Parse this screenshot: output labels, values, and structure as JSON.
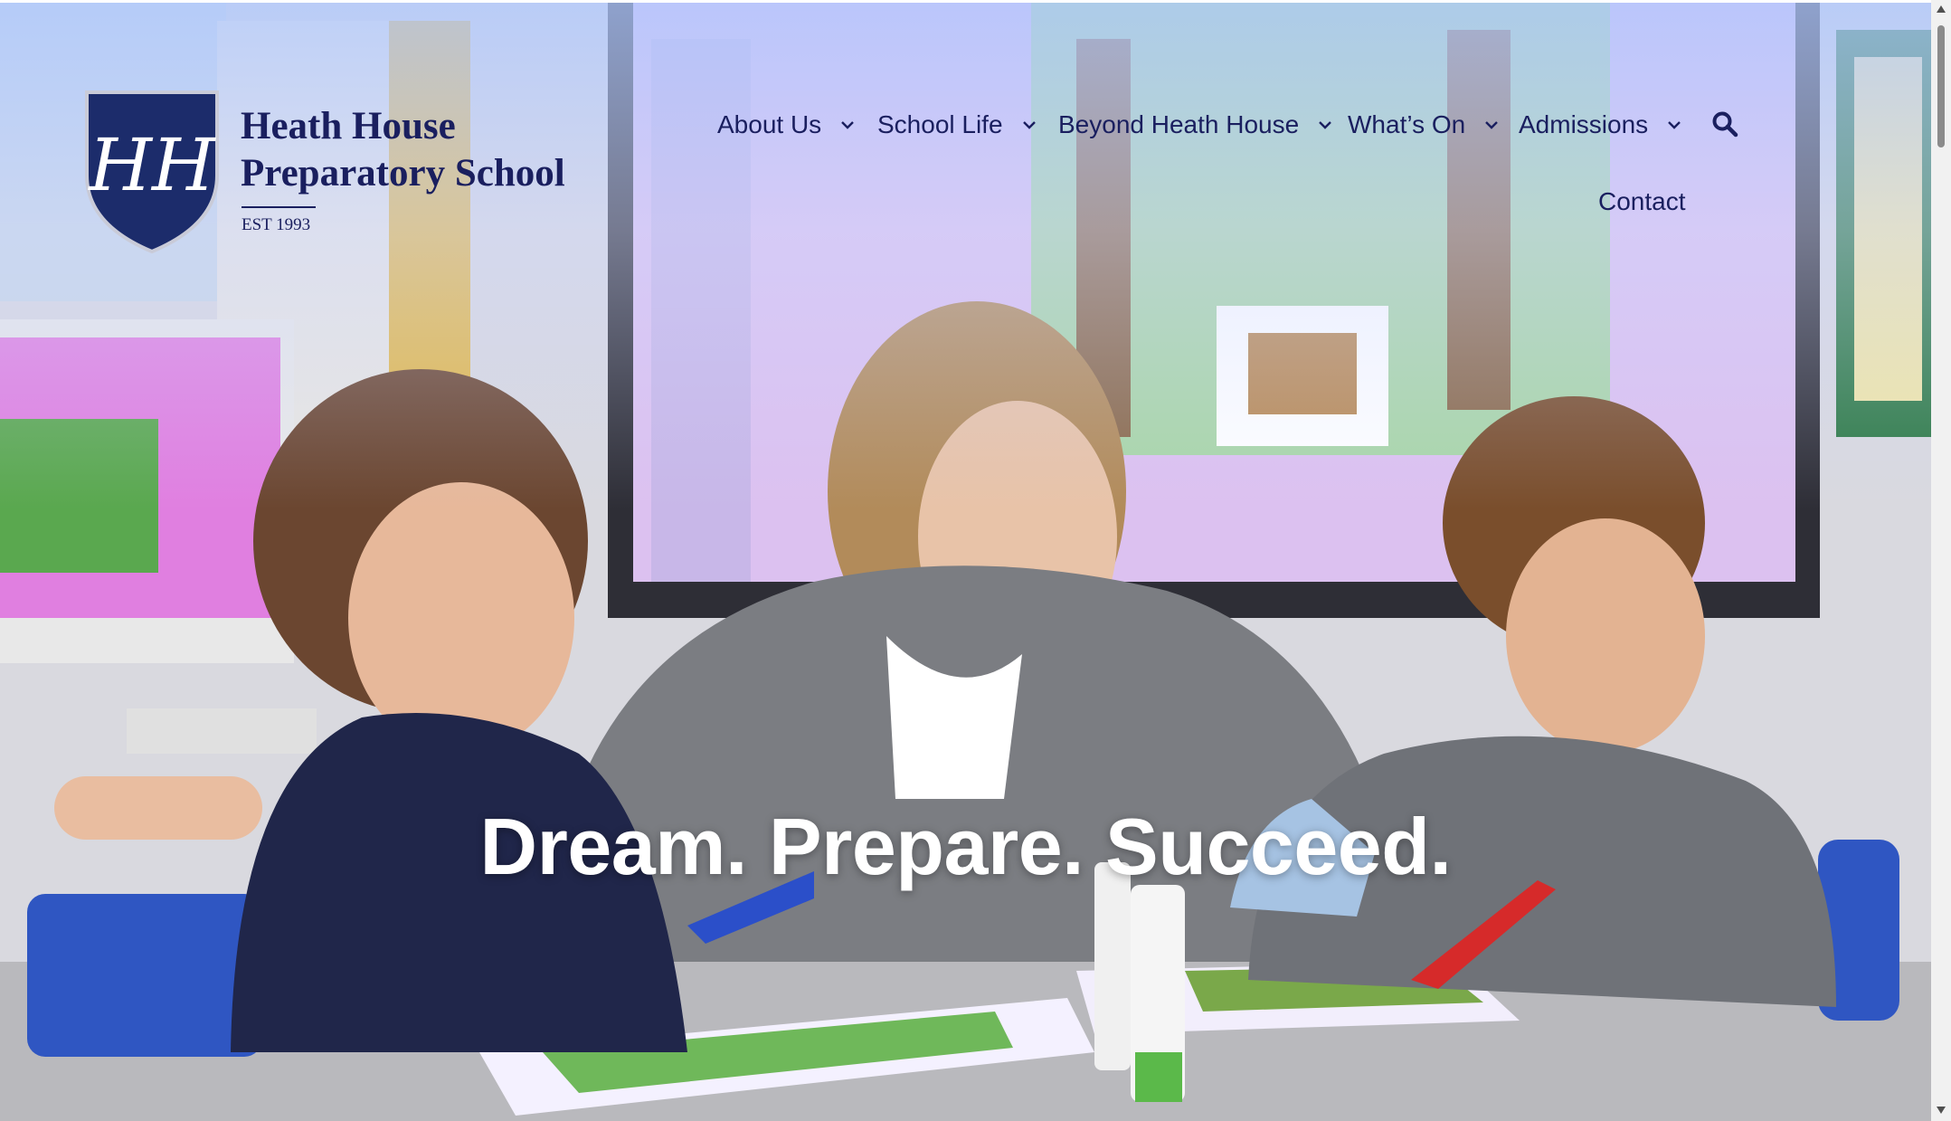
{
  "site": {
    "name_line1": "Heath House",
    "name_line2": "Preparatory School",
    "established": "EST 1993",
    "crest_monogram": "HH"
  },
  "nav": {
    "items": [
      {
        "label": "About Us",
        "icon": "chevron-down-icon"
      },
      {
        "label": "School Life",
        "icon": "chevron-down-icon"
      },
      {
        "label": "Beyond Heath House",
        "icon": "chevron-down-icon"
      },
      {
        "label": "What’s On",
        "icon": "chevron-down-icon"
      },
      {
        "label": "Admissions",
        "icon": "chevron-down-icon"
      }
    ],
    "search_icon": "search-icon",
    "contact_label": "Contact"
  },
  "hero": {
    "tagline": "Dream. Prepare. Succeed."
  },
  "colors": {
    "brand_navy": "#1a1f5f",
    "crest_blue": "#1c2c6b",
    "tagline_white": "#ffffff"
  }
}
